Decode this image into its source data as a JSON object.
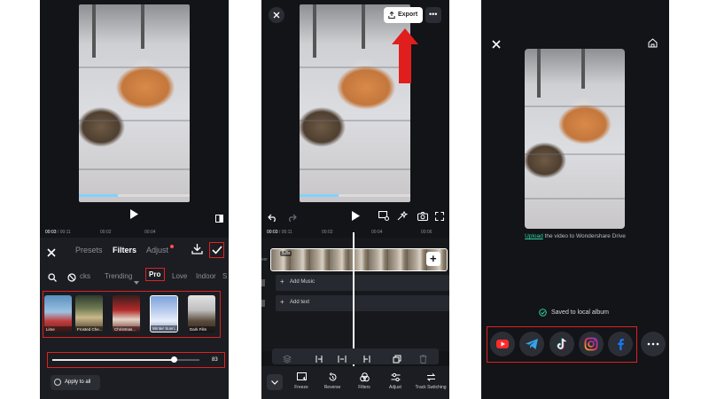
{
  "panel1": {
    "time_current": "00:03",
    "time_total": "00:11",
    "ruler_ticks": [
      "00:02",
      "00:04"
    ],
    "tabs": [
      "Presets",
      "Filters",
      "Adjust"
    ],
    "active_tab": "Filters",
    "categories": [
      "cks",
      "Trending",
      "Pro",
      "Love",
      "Indoor",
      "S"
    ],
    "filters": [
      {
        "name": "Lime"
      },
      {
        "name": "Frosted Che..."
      },
      {
        "name": "Christmas..."
      },
      {
        "name": "Winter Sunri..."
      },
      {
        "name": "Dark Film"
      }
    ],
    "intensity": 83,
    "intensity_label": "83",
    "apply_all": "Apply to all",
    "colors": {
      "accent_red": "#e02020",
      "bg": "#121418"
    }
  },
  "panel2": {
    "export_label": "Export",
    "time_current": "00:03",
    "time_total": "00:11",
    "ruler_ticks": [
      "00:02",
      "00:04",
      "00:06"
    ],
    "clip_badge": "5.8s",
    "add_music": "Add Music",
    "add_text": "Add text",
    "side_label": "ver",
    "bottom_tools": [
      "Freeze",
      "Reverse",
      "Filters",
      "Adjust",
      "Track Switching"
    ]
  },
  "panel3": {
    "upload_link": "Upload",
    "upload_text": " the video to Wondershare Drive",
    "saved_text": "Saved to local album",
    "share_targets": [
      "youtube-icon",
      "telegram-icon",
      "tiktok-icon",
      "instagram-icon",
      "facebook-icon",
      "more-icon"
    ]
  }
}
